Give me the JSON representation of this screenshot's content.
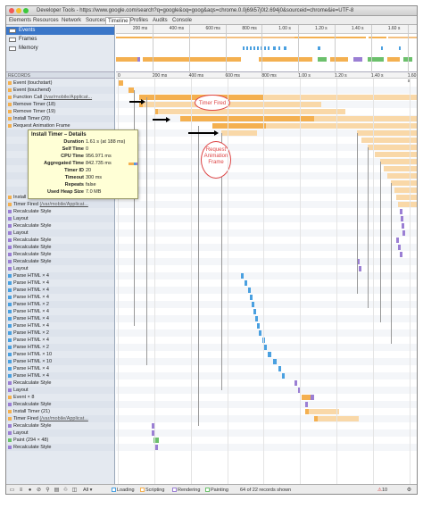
{
  "window": {
    "title": "Developer Tools - https://www.google.com/search?q=google&oq=goog&aqs=chrome.0.0j69i57j0l2.694j0&sourceid=chrome&ie=UTF-8"
  },
  "tabs": [
    "Elements",
    "Resources",
    "Network",
    "Sources",
    "Timeline",
    "Profiles",
    "Audits",
    "Console"
  ],
  "active_tab": "Timeline",
  "overview": [
    {
      "label": "Events",
      "selected": true
    },
    {
      "label": "Frames",
      "selected": false
    },
    {
      "label": "Memory",
      "selected": false
    }
  ],
  "records_header": "RECORDS",
  "overview_ticks": [
    "200 ms",
    "400 ms",
    "600 ms",
    "800 ms",
    "1.00 s",
    "1.20 s",
    "1.40 s",
    "1.60 s"
  ],
  "ruler_ticks": [
    "0",
    "200 ms",
    "400 ms",
    "600 ms",
    "800 ms",
    "1.00 s",
    "1.20 s",
    "1.40 s",
    "1.60 s"
  ],
  "records": [
    {
      "label": "Event (touchstart)",
      "color": "#f4b050"
    },
    {
      "label": "Event (touchend)",
      "color": "#f4b050"
    },
    {
      "label": "Function Call ",
      "source": "(/var/mobile/Applicat...",
      "color": "#f4b050"
    },
    {
      "label": "Remove Timer (18)",
      "color": "#f4b050"
    },
    {
      "label": "Remove Timer (19)",
      "color": "#f4b050"
    },
    {
      "label": "Install Timer (20)",
      "color": "#f4b050"
    },
    {
      "label": "Request Animation Frame",
      "color": "#f4b050"
    },
    {
      "label": "",
      "color": ""
    },
    {
      "label": "",
      "color": ""
    },
    {
      "label": "",
      "color": ""
    },
    {
      "label": "",
      "color": ""
    },
    {
      "label": "",
      "color": ""
    },
    {
      "label": "",
      "color": ""
    },
    {
      "label": "",
      "color": ""
    },
    {
      "label": "",
      "color": ""
    },
    {
      "label": "",
      "color": ""
    },
    {
      "label": "Install Timer (24)",
      "color": "#f4b050"
    },
    {
      "label": "Timer Fired ",
      "source": "(/var/mobile/Applicat...",
      "color": "#f4b050"
    },
    {
      "label": "Recalculate Style",
      "color": "#9b7fd4"
    },
    {
      "label": "Layout",
      "color": "#9b7fd4"
    },
    {
      "label": "Recalculate Style",
      "color": "#9b7fd4"
    },
    {
      "label": "Layout",
      "color": "#9b7fd4"
    },
    {
      "label": "Recalculate Style",
      "color": "#9b7fd4"
    },
    {
      "label": "Recalculate Style",
      "color": "#9b7fd4"
    },
    {
      "label": "Recalculate Style",
      "color": "#9b7fd4"
    },
    {
      "label": "Recalculate Style",
      "color": "#9b7fd4"
    },
    {
      "label": "Layout",
      "color": "#9b7fd4"
    },
    {
      "label": "Parse HTML × 4",
      "color": "#4aa0e0"
    },
    {
      "label": "Parse HTML × 4",
      "color": "#4aa0e0"
    },
    {
      "label": "Parse HTML × 4",
      "color": "#4aa0e0"
    },
    {
      "label": "Parse HTML × 4",
      "color": "#4aa0e0"
    },
    {
      "label": "Parse HTML × 2",
      "color": "#4aa0e0"
    },
    {
      "label": "Parse HTML × 4",
      "color": "#4aa0e0"
    },
    {
      "label": "Parse HTML × 4",
      "color": "#4aa0e0"
    },
    {
      "label": "Parse HTML × 4",
      "color": "#4aa0e0"
    },
    {
      "label": "Parse HTML × 2",
      "color": "#4aa0e0"
    },
    {
      "label": "Parse HTML × 4",
      "color": "#4aa0e0"
    },
    {
      "label": "Parse HTML × 2",
      "color": "#4aa0e0"
    },
    {
      "label": "Parse HTML × 10",
      "color": "#4aa0e0"
    },
    {
      "label": "Parse HTML × 10",
      "color": "#4aa0e0"
    },
    {
      "label": "Parse HTML × 4",
      "color": "#4aa0e0"
    },
    {
      "label": "Parse HTML × 4",
      "color": "#4aa0e0"
    },
    {
      "label": "Recalculate Style",
      "color": "#9b7fd4"
    },
    {
      "label": "Layout",
      "color": "#9b7fd4"
    },
    {
      "label": "Event × 8",
      "color": "#f4b050"
    },
    {
      "label": "Recalculate Style",
      "color": "#9b7fd4"
    },
    {
      "label": "Install Timer (21)",
      "color": "#f4b050"
    },
    {
      "label": "Timer Fired ",
      "source": "(/var/mobile/Applicat...",
      "color": "#f4b050"
    },
    {
      "label": "Recalculate Style",
      "color": "#9b7fd4"
    },
    {
      "label": "Layout",
      "color": "#9b7fd4"
    },
    {
      "label": "Paint (294 × 48)",
      "color": "#6cc06c"
    },
    {
      "label": "Recalculate Style",
      "color": "#9b7fd4"
    }
  ],
  "popover": {
    "title": "Install Timer – Details",
    "rows": [
      {
        "label": "Duration",
        "value": "1.61 s (at 188 ms)"
      },
      {
        "label": "Self Time",
        "value": "0"
      },
      {
        "label": "CPU Time",
        "value": "956.971 ms"
      },
      {
        "label": "Aggregated Time",
        "value": "842.735 ms"
      },
      {
        "label": "Timer ID",
        "value": "20"
      },
      {
        "label": "Timeout",
        "value": "300 ms"
      },
      {
        "label": "Repeats",
        "value": "false"
      },
      {
        "label": "Used Heap Size",
        "value": "7.0 MB"
      }
    ]
  },
  "callouts": {
    "timer_fired": "Timer Fired",
    "request_animation_frame": "Request Animation Frame"
  },
  "statusbar": {
    "filter_value": "All",
    "checkboxes": [
      "Loading",
      "Scripting",
      "Rendering",
      "Painting"
    ],
    "records_shown": "64 of 22 records shown",
    "error_count": "10"
  },
  "colors": {
    "loading": "#4aa0e0",
    "scripting": "#f4b050",
    "rendering": "#9b7fd4",
    "painting": "#6cc06c",
    "selected": "#3a76c8"
  }
}
